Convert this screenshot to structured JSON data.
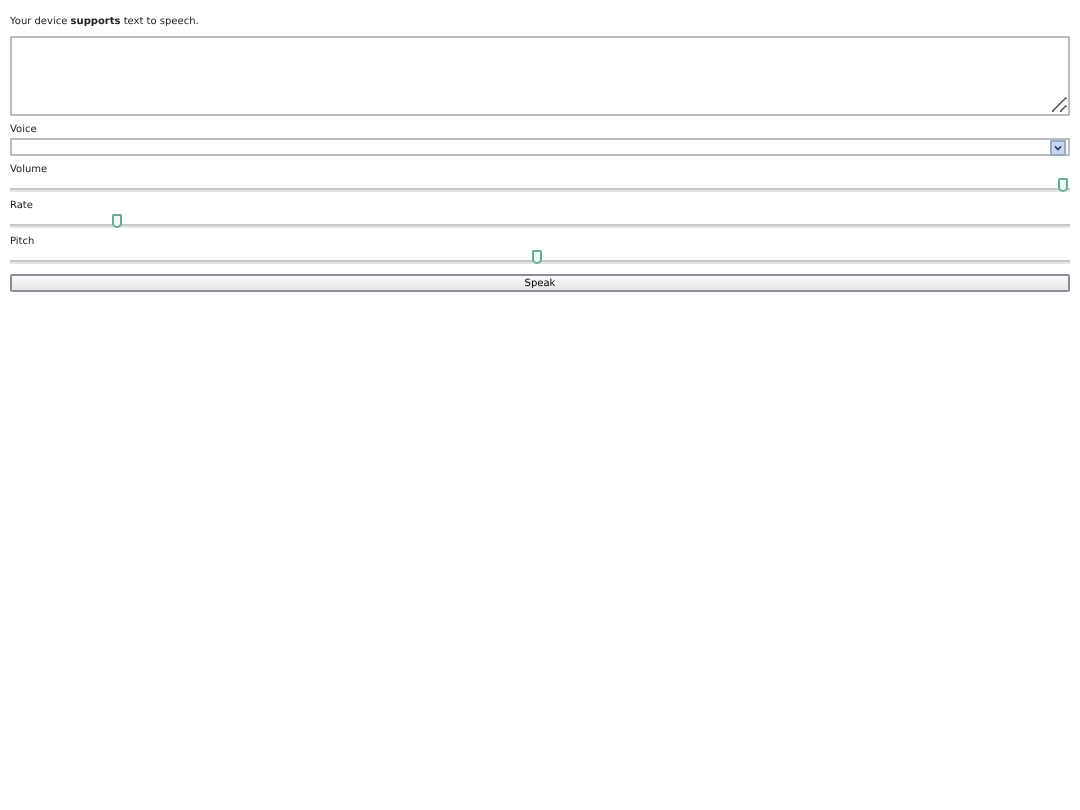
{
  "status_text": "Your device **supports** text to speech.",
  "voice": {
    "label": "Voice"
  },
  "sliders": [
    {
      "label": "Volume",
      "level": 1
    },
    {
      "label": "Rate",
      "level": 0.1
    },
    {
      "label": "Pitch",
      "level": 0.5
    }
  ],
  "button": "Speak"
}
